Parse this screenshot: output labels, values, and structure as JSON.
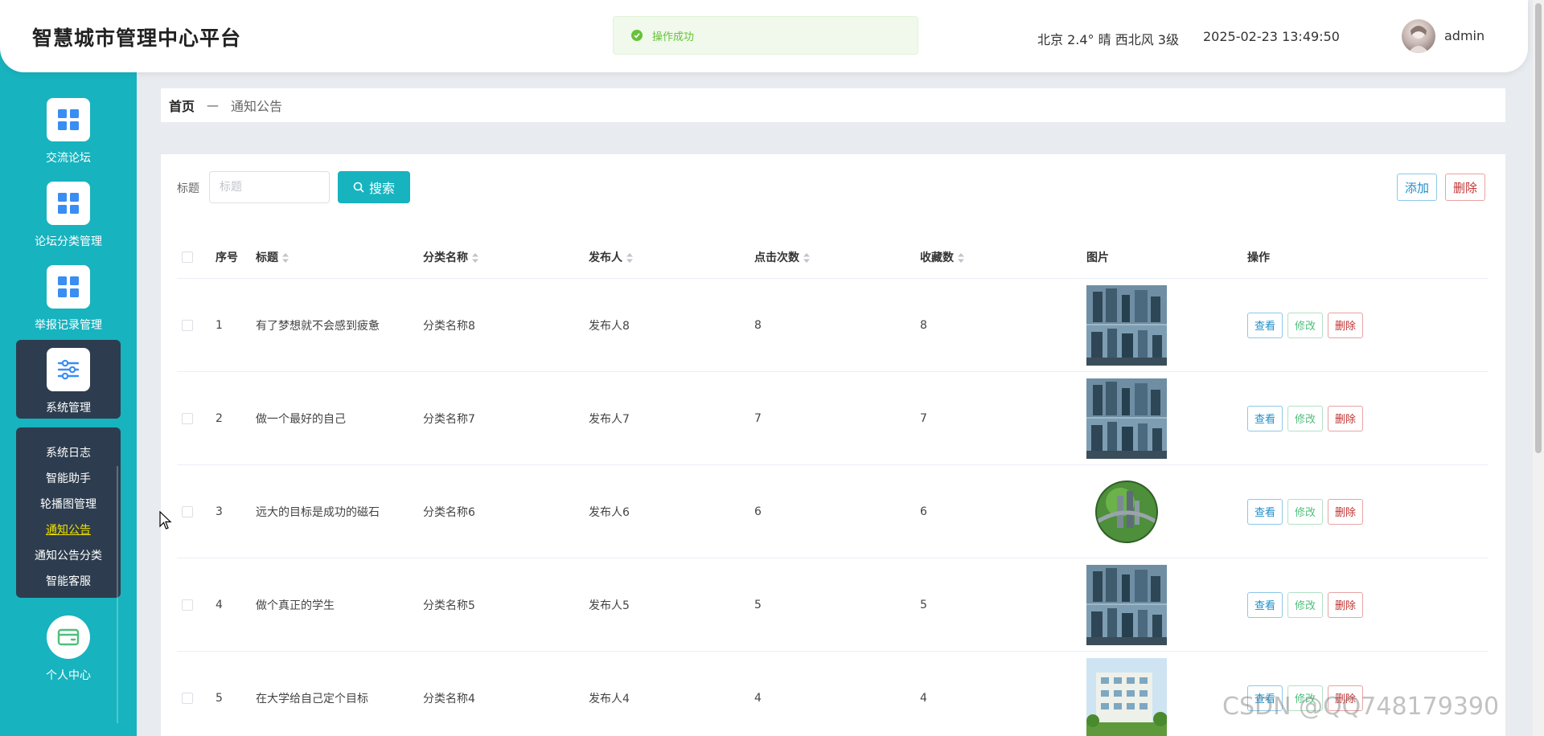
{
  "header": {
    "app_title": "智慧城市管理中心平台",
    "toast": "操作成功",
    "weather": "北京  2.4°  晴  西北风  3级",
    "datetime": "2025-02-23 13:49:50",
    "username": "admin"
  },
  "sidebar": {
    "items": [
      {
        "label": "交流论坛",
        "icon": "grid-icon"
      },
      {
        "label": "论坛分类管理",
        "icon": "grid-icon"
      },
      {
        "label": "举报记录管理",
        "icon": "grid-icon"
      },
      {
        "label": "系统管理",
        "icon": "sliders-icon"
      },
      {
        "label": "个人中心",
        "icon": "wallet-icon"
      }
    ],
    "submenu": [
      "系统日志",
      "智能助手",
      "轮播图管理",
      "通知公告",
      "通知公告分类",
      "智能客服"
    ],
    "active_submenu": "通知公告"
  },
  "breadcrumb": {
    "home": "首页",
    "separator": "—",
    "current": "通知公告"
  },
  "search": {
    "label": "标题",
    "placeholder": "标题",
    "button": "搜索"
  },
  "toolbar": {
    "add": "添加",
    "delete": "删除"
  },
  "table": {
    "headers": [
      "序号",
      "标题",
      "分类名称",
      "发布人",
      "点击次数",
      "收藏数",
      "图片",
      "操作"
    ],
    "row_actions": {
      "view": "查看",
      "edit": "修改",
      "delete": "删除"
    },
    "rows": [
      {
        "idx": "1",
        "title": "有了梦想就不会感到疲惫",
        "category": "分类名称8",
        "publisher": "发布人8",
        "clicks": "8",
        "favs": "8",
        "image": "city-towers"
      },
      {
        "idx": "2",
        "title": "做一个最好的自己",
        "category": "分类名称7",
        "publisher": "发布人7",
        "clicks": "7",
        "favs": "7",
        "image": "city-towers"
      },
      {
        "idx": "3",
        "title": "远大的目标是成功的磁石",
        "category": "分类名称6",
        "publisher": "发布人6",
        "clicks": "6",
        "favs": "6",
        "image": "green-globe"
      },
      {
        "idx": "4",
        "title": "做个真正的学生",
        "category": "分类名称5",
        "publisher": "发布人5",
        "clicks": "5",
        "favs": "5",
        "image": "city-towers"
      },
      {
        "idx": "5",
        "title": "在大学给自己定个目标",
        "category": "分类名称4",
        "publisher": "发布人4",
        "clicks": "4",
        "favs": "4",
        "image": "apartment-building"
      }
    ]
  },
  "watermark": "CSDN @QQ748179390",
  "colors": {
    "accent": "#17b3bf",
    "sidebar_active": "#2d3d4f",
    "success": "#67c23a"
  }
}
